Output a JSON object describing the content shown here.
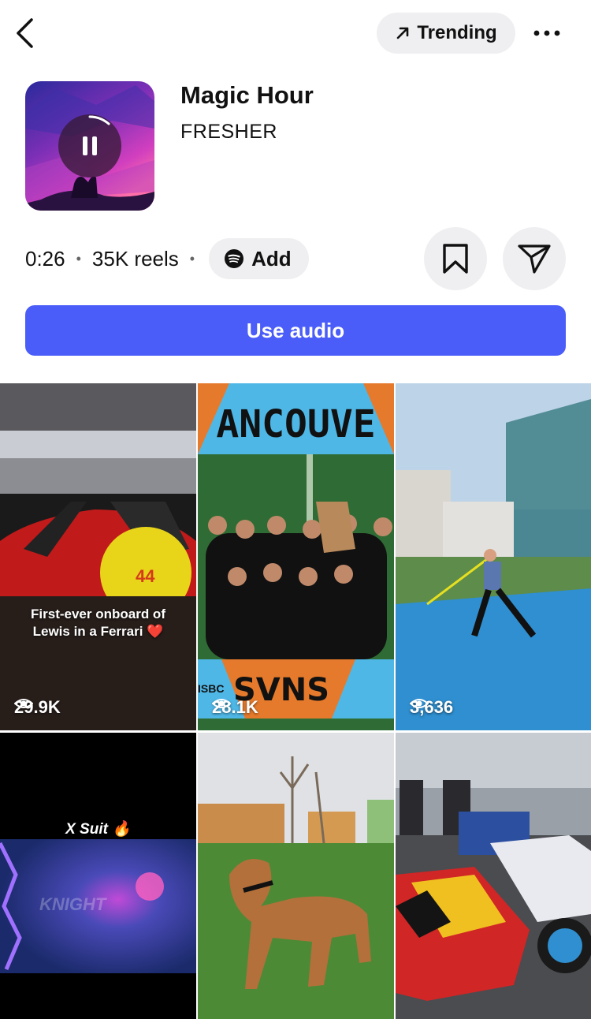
{
  "header": {
    "back_icon": "chevron-left-icon",
    "trending_label": "Trending",
    "trending_icon": "arrow-up-right-icon",
    "more_icon": "more-horizontal-icon"
  },
  "audio": {
    "title": "Magic Hour",
    "artist": "FRESHER",
    "duration": "0:26",
    "reels_count": "35K reels",
    "add_label": "Add",
    "add_icon": "spotify-icon",
    "save_icon": "bookmark-icon",
    "share_icon": "send-icon",
    "use_audio_label": "Use audio",
    "accent_color": "#4a5df9"
  },
  "reels": [
    {
      "caption": "First-ever onboard of\nLewis in a Ferrari ❤️",
      "views": "29.9K"
    },
    {
      "caption": "",
      "views": "28.1K",
      "scene_text_top": "ANCOUVE",
      "scene_text_bottom": "SVNS",
      "scene_text_small": "ISBC"
    },
    {
      "caption": "",
      "views": "3,636"
    },
    {
      "caption": "X Suit 🔥",
      "views": "",
      "scene_text": "KNIGHT"
    },
    {
      "caption": "",
      "views": ""
    },
    {
      "caption": "",
      "views": ""
    }
  ]
}
